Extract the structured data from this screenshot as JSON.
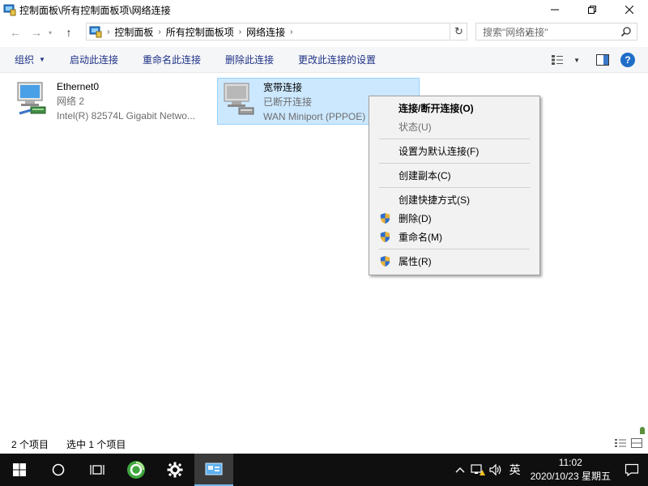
{
  "window": {
    "title": "控制面板\\所有控制面板项\\网络连接",
    "icons": {
      "app": "control-panel-icon",
      "minimize": "minimize-icon",
      "maximize": "maximize-icon",
      "close": "close-icon"
    }
  },
  "address": {
    "crumbs": [
      "控制面板",
      "所有控制面板项",
      "网络连接"
    ],
    "search_placeholder": "搜索\"网络连接\""
  },
  "commands": {
    "organize": "组织",
    "enable": "启动此连接",
    "rename": "重命名此连接",
    "delete": "删除此连接",
    "change_settings": "更改此连接的设置"
  },
  "connections": [
    {
      "name": "Ethernet0",
      "status": "网络 2",
      "device": "Intel(R) 82574L Gigabit Netwo...",
      "icon": "ethernet-adapter-icon",
      "selected": false
    },
    {
      "name": "宽带连接",
      "status": "已断开连接",
      "device": "WAN Miniport (PPPOE)",
      "icon": "broadband-adapter-icon",
      "selected": true
    }
  ],
  "context_menu": {
    "items": [
      {
        "label": "连接/断开连接(O)",
        "bold": true
      },
      {
        "label": "状态(U)",
        "disabled": true
      },
      {
        "separator": true
      },
      {
        "label": "设置为默认连接(F)"
      },
      {
        "separator": true
      },
      {
        "label": "创建副本(C)"
      },
      {
        "separator": true
      },
      {
        "label": "创建快捷方式(S)"
      },
      {
        "label": "删除(D)",
        "icon": "uac-shield-icon"
      },
      {
        "label": "重命名(M)",
        "icon": "uac-shield-icon"
      },
      {
        "separator": true
      },
      {
        "label": "属性(R)",
        "icon": "uac-shield-icon"
      }
    ]
  },
  "status": {
    "count": "2 个项目",
    "selected": "选中 1 个项目"
  },
  "taskbar": {
    "time": "11:02",
    "date": "2020/10/23 星期五",
    "ime": "英"
  },
  "colors": {
    "command_text": "#1e3287",
    "selection_bg": "#cce8ff",
    "selection_border": "#99d1ff",
    "taskbar_bg": "#0f0f0f"
  }
}
